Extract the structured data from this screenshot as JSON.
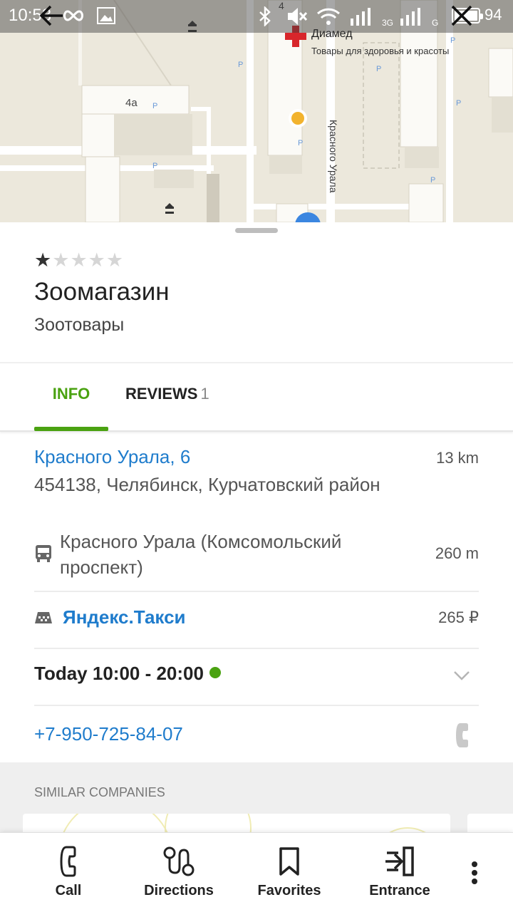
{
  "status_bar": {
    "time": "10:53",
    "battery_level": "94",
    "signal_labels": [
      "3G",
      "G"
    ]
  },
  "map": {
    "poi_name": "Диамед",
    "poi_category": "Товары для здоровья и красоты",
    "building_label_1": "4а",
    "building_label_2": "4",
    "street_label": "Красного Урала",
    "back_icon": "arrow-left-icon",
    "close_icon": "close-icon"
  },
  "place": {
    "rating": {
      "filled": 1,
      "total": 5
    },
    "name": "Зоомагазин",
    "category": "Зоотовары"
  },
  "tabs": {
    "info_label": "INFO",
    "reviews_label": "REVIEWS",
    "reviews_count": "1",
    "active": "info"
  },
  "address": {
    "street": "Красного Урала, 6",
    "distance": "13 km",
    "detail": "454138, Челябинск, Курчатовский район"
  },
  "transit": {
    "icon": "bus-icon",
    "stop": "Красного Урала (Комсомольский проспект)",
    "distance": "260 m"
  },
  "taxi": {
    "icon": "taxi-icon",
    "label": "Яндекс.Такси",
    "price": "265 ₽"
  },
  "hours": {
    "text": "Today 10:00 - 20:00",
    "open_color": "#4aa211"
  },
  "phone": {
    "number": "+7-950-725-84-07"
  },
  "similar": {
    "title": "SIMILAR COMPANIES"
  },
  "bottom_bar": {
    "call_label": "Call",
    "directions_label": "Directions",
    "favorites_label": "Favorites",
    "entrance_label": "Entrance"
  },
  "colors": {
    "accent_green": "#4aa211",
    "link_blue": "#1f7ccc"
  }
}
